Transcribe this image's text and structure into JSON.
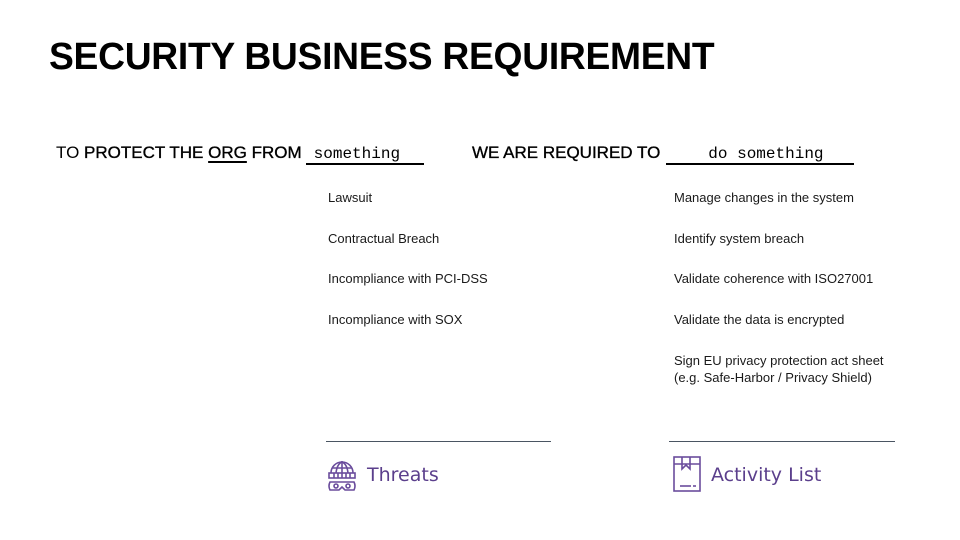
{
  "title": "SECURITY BUSINESS REQUIREMENT",
  "sentence_left": {
    "to": "TO",
    "protect_the": "PROTECT THE",
    "org": "ORG",
    "from": "FROM",
    "blank_value": "something"
  },
  "sentence_right": {
    "prefix": "WE ARE REQUIRED TO",
    "blank_value": "do something"
  },
  "threats": {
    "items": [
      "Lawsuit",
      "Contractual Breach",
      "Incompliance with PCI-DSS",
      "Incompliance with SOX"
    ],
    "footer_label": "Threats",
    "icon": "hacker-icon"
  },
  "activities": {
    "items": [
      "Manage changes in the system",
      "Identify system breach",
      "Validate coherence with ISO27001",
      "Validate the data is encrypted",
      "Sign EU privacy protection act sheet",
      "(e.g. Safe-Harbor / Privacy Shield)"
    ],
    "footer_label": "Activity List",
    "icon": "box-list-icon"
  },
  "colors": {
    "accent": "#5b3f8c",
    "divider": "#4a5562",
    "text": "#000000"
  }
}
